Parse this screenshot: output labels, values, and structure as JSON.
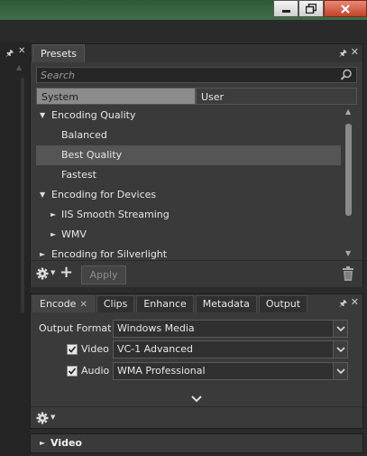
{
  "window": {
    "controls": {
      "minimize_icon": "minimize-icon",
      "restore_icon": "restore-icon",
      "close_icon": "close-icon"
    },
    "colors": {
      "titlebar": "#3f6e48",
      "close_button": "#c2432a",
      "panel_bg": "#3a3a3a",
      "selected_row": "#555555"
    }
  },
  "left_strip": {
    "pin_glyph": "🖈",
    "close_glyph": "✕",
    "scroll_up_glyph": "▲"
  },
  "presets": {
    "title": "Presets",
    "pin_glyph": "🖈",
    "close_glyph": "✕",
    "search_placeholder": "Search",
    "search_value": "",
    "segments": {
      "system": "System",
      "user": "User",
      "selected": "System"
    },
    "tree": [
      {
        "label": "Encoding Quality",
        "expanded": true
      },
      {
        "label": "Balanced"
      },
      {
        "label": "Best Quality",
        "selected": true
      },
      {
        "label": "Fastest"
      },
      {
        "label": "Encoding for Devices",
        "expanded": true
      },
      {
        "label": "IIS Smooth Streaming",
        "expanded": false
      },
      {
        "label": "WMV",
        "expanded": false
      },
      {
        "label": "Encoding for Silverlight",
        "expanded": false
      }
    ],
    "glyphs": {
      "expanded": "▼",
      "collapsed": "►",
      "scroll_up": "▲",
      "scroll_down": "▼",
      "add": "+",
      "caret": "▼"
    },
    "apply_label": "Apply",
    "apply_enabled": false
  },
  "encode": {
    "tabs": [
      {
        "label": "Encode",
        "active": true,
        "close_glyph": "✕"
      },
      {
        "label": "Clips"
      },
      {
        "label": "Enhance"
      },
      {
        "label": "Metadata"
      },
      {
        "label": "Output"
      }
    ],
    "pin_glyph": "🖈",
    "close_glyph": "✕",
    "output_format_label": "Output Format",
    "output_format_value": "Windows Media",
    "video_label": "Video",
    "video_checked": true,
    "video_codec": "VC-1 Advanced",
    "audio_label": "Audio",
    "audio_checked": true,
    "audio_codec": "WMA Professional",
    "caret_glyph": "▼"
  },
  "video_section": {
    "label": "Video",
    "expand_glyph": "►"
  }
}
